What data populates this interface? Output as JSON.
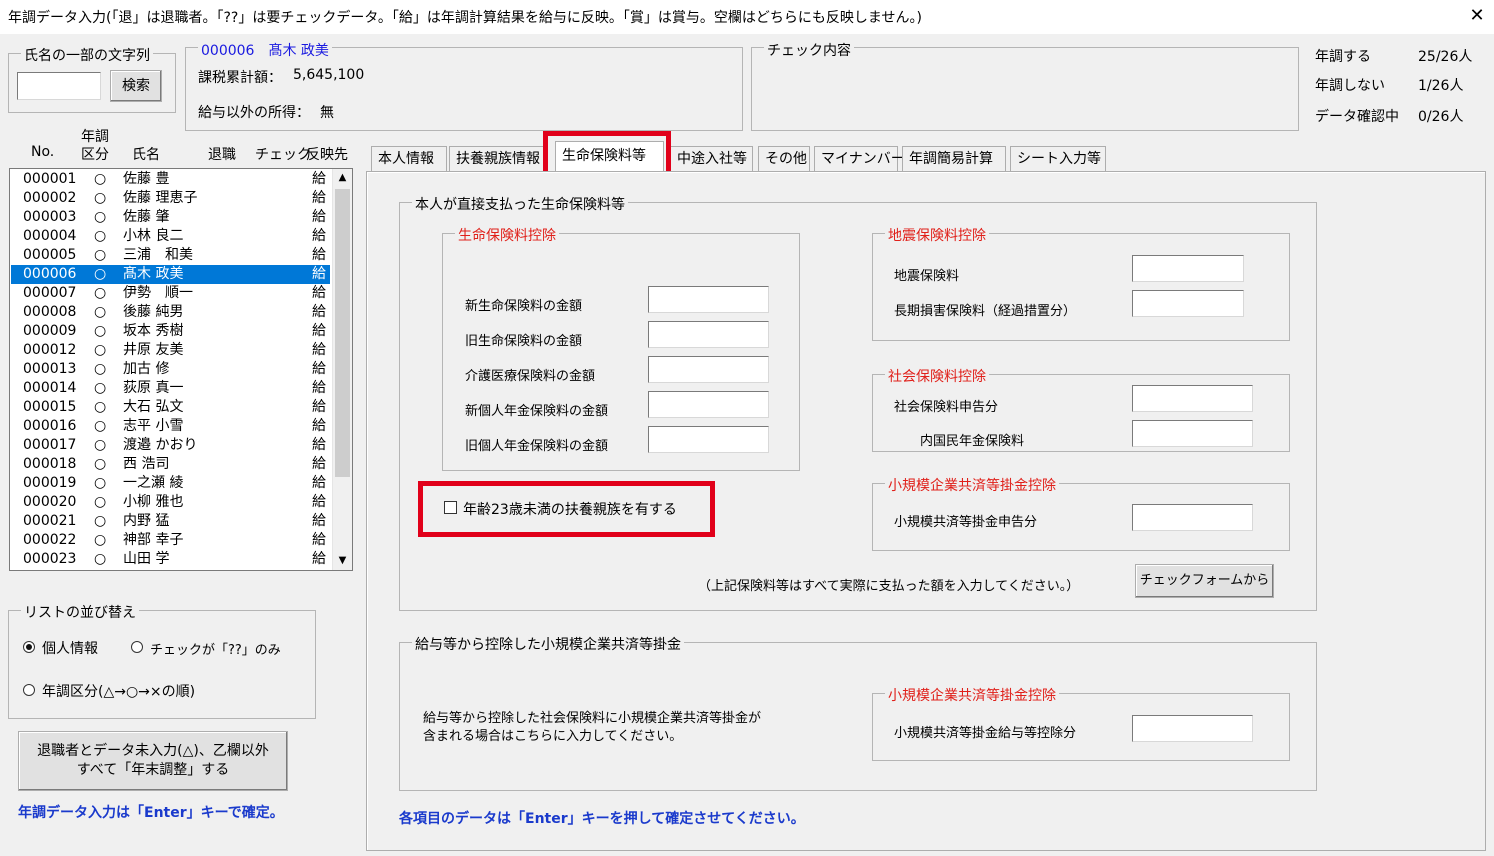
{
  "window": {
    "title": "年調データ入力(「退」は退職者。「??」は要チェックデータ。「給」は年調計算結果を給与に反映。「賞」は賞与。空欄はどちらにも反映しません。)",
    "close": "✕"
  },
  "search": {
    "group_label": "氏名の一部の文字列",
    "input_value": "",
    "button": "検索"
  },
  "employee": {
    "code_name": "000006　髙木 政美",
    "taxable_label": "課税累計額：",
    "taxable_value": "5,645,100",
    "other_income_label": "給与以外の所得：",
    "other_income_value": "無"
  },
  "check": {
    "group_label": "チェック内容"
  },
  "stats": [
    {
      "label": "年調する",
      "value": "25/26人"
    },
    {
      "label": "年調しない",
      "value": "1/26人"
    },
    {
      "label": "データ確認中",
      "value": "0/26人"
    }
  ],
  "list": {
    "headers": {
      "no": "No.",
      "nencho_top": "年調",
      "nencho_bottom": "区分",
      "name": "氏名",
      "retire": "退職",
      "check": "チェック",
      "reflect": "反映先"
    },
    "rows": [
      {
        "no": "000001",
        "kubun": "○",
        "name": "佐藤 豊",
        "reflect": "給"
      },
      {
        "no": "000002",
        "kubun": "○",
        "name": "佐藤 理恵子",
        "reflect": "給"
      },
      {
        "no": "000003",
        "kubun": "○",
        "name": "佐藤 肇",
        "reflect": "給"
      },
      {
        "no": "000004",
        "kubun": "○",
        "name": "小林 良二",
        "reflect": "給"
      },
      {
        "no": "000005",
        "kubun": "○",
        "name": "三浦　和美",
        "reflect": "給"
      },
      {
        "no": "000006",
        "kubun": "○",
        "name": "髙木 政美",
        "reflect": "給",
        "selected": true
      },
      {
        "no": "000007",
        "kubun": "○",
        "name": "伊勢　順一",
        "reflect": "給"
      },
      {
        "no": "000008",
        "kubun": "○",
        "name": "後藤 純男",
        "reflect": "給"
      },
      {
        "no": "000009",
        "kubun": "○",
        "name": "坂本 秀樹",
        "reflect": "給"
      },
      {
        "no": "000012",
        "kubun": "○",
        "name": "井原 友美",
        "reflect": "給"
      },
      {
        "no": "000013",
        "kubun": "○",
        "name": "加古 修",
        "reflect": "給"
      },
      {
        "no": "000014",
        "kubun": "○",
        "name": "荻原 真一",
        "reflect": "給"
      },
      {
        "no": "000015",
        "kubun": "○",
        "name": "大石 弘文",
        "reflect": "給"
      },
      {
        "no": "000016",
        "kubun": "○",
        "name": "志平 小雪",
        "reflect": "給"
      },
      {
        "no": "000017",
        "kubun": "○",
        "name": "渡邉 かおり",
        "reflect": "給"
      },
      {
        "no": "000018",
        "kubun": "○",
        "name": "西 浩司",
        "reflect": "給"
      },
      {
        "no": "000019",
        "kubun": "○",
        "name": "一之瀬 綾",
        "reflect": "給"
      },
      {
        "no": "000020",
        "kubun": "○",
        "name": "小柳 雅也",
        "reflect": "給"
      },
      {
        "no": "000021",
        "kubun": "○",
        "name": "内野 猛",
        "reflect": "給"
      },
      {
        "no": "000022",
        "kubun": "○",
        "name": "神部 幸子",
        "reflect": "給"
      },
      {
        "no": "000023",
        "kubun": "○",
        "name": "山田 学",
        "reflect": "給"
      }
    ]
  },
  "sort": {
    "group_label": "リストの並び替え",
    "opt1": "個人情報",
    "opt2": "チェックが「??」のみ",
    "opt3": "年調区分(△→○→×の順)"
  },
  "bulk_button": {
    "line1": "退職者とデータ未入力(△)、乙欄以外",
    "line2": "すべて「年末調整」する"
  },
  "left_note": "年調データ入力は「Enter」キーで確定。",
  "tabs": [
    "本人情報",
    "扶養親族情報",
    "生命保険料等",
    "中途入社等",
    "その他",
    "マイナンバー",
    "年調簡易計算",
    "シート入力等"
  ],
  "main": {
    "group1_label": "本人が直接支払った生命保険料等",
    "life": {
      "label": "生命保険料控除",
      "fields": [
        "新生命保険料の金額",
        "旧生命保険料の金額",
        "介護医療保険料の金額",
        "新個人年金保険料の金額",
        "旧個人年金保険料の金額"
      ]
    },
    "earthquake": {
      "label": "地震保険料控除",
      "fields": [
        "地震保険料",
        "長期損害保険料（経過措置分）"
      ]
    },
    "social": {
      "label": "社会保険料控除",
      "fields": [
        "社会保険料申告分",
        "内国民年金保険料"
      ]
    },
    "small_biz": {
      "label": "小規模企業共済等掛金控除",
      "field": "小規模共済等掛金申告分"
    },
    "checkbox_label": "年齢23歳未満の扶養親族を有する",
    "note": "（上記保険料等はすべて実際に支払った額を入力してください。）",
    "check_form_button": "チェックフォームから",
    "group2_label": "給与等から控除した小規模企業共済等掛金",
    "group2_text_line1": "給与等から控除した社会保険料に小規模企業共済等掛金が",
    "group2_text_line2": "含まれる場合はこちらに入力してください。",
    "small_biz2": {
      "label": "小規模企業共済等掛金控除",
      "field": "小規模共済等掛金給与等控除分"
    },
    "footer_note": "各項目のデータは「Enter」キーを押して確定させてください。"
  }
}
